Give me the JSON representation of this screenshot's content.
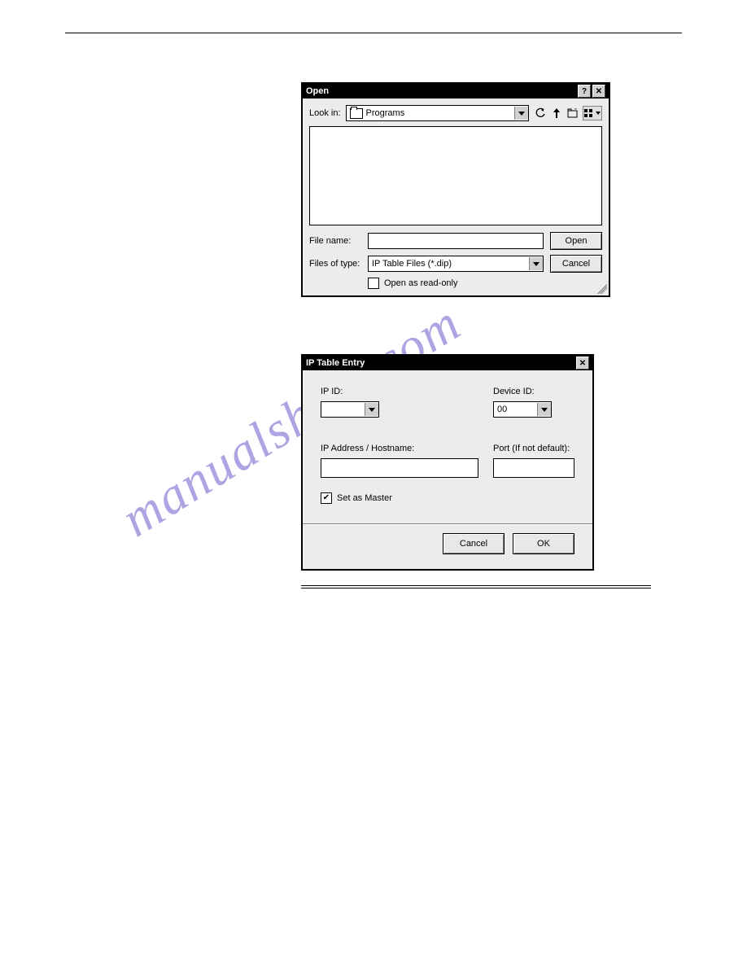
{
  "open_dialog": {
    "title": "Open",
    "look_in_label": "Look in:",
    "look_in_value": "Programs",
    "file_name_label": "File name:",
    "file_name_value": "",
    "files_of_type_label": "Files of type:",
    "files_of_type_value": "IP Table Files (*.dip)",
    "open_btn": "Open",
    "cancel_btn": "Cancel",
    "read_only_label": "Open as read-only",
    "read_only_checked": false
  },
  "ip_dialog": {
    "title": "IP Table Entry",
    "ip_id_label": "IP ID:",
    "ip_id_value": "",
    "device_id_label": "Device ID:",
    "device_id_value": "00",
    "address_label": "IP Address / Hostname:",
    "address_value": "",
    "port_label": "Port (If not default):",
    "port_value": "",
    "set_master_label": "Set as Master",
    "set_master_checked": true,
    "cancel_btn": "Cancel",
    "ok_btn": "OK"
  },
  "watermark": "manualshive.com"
}
